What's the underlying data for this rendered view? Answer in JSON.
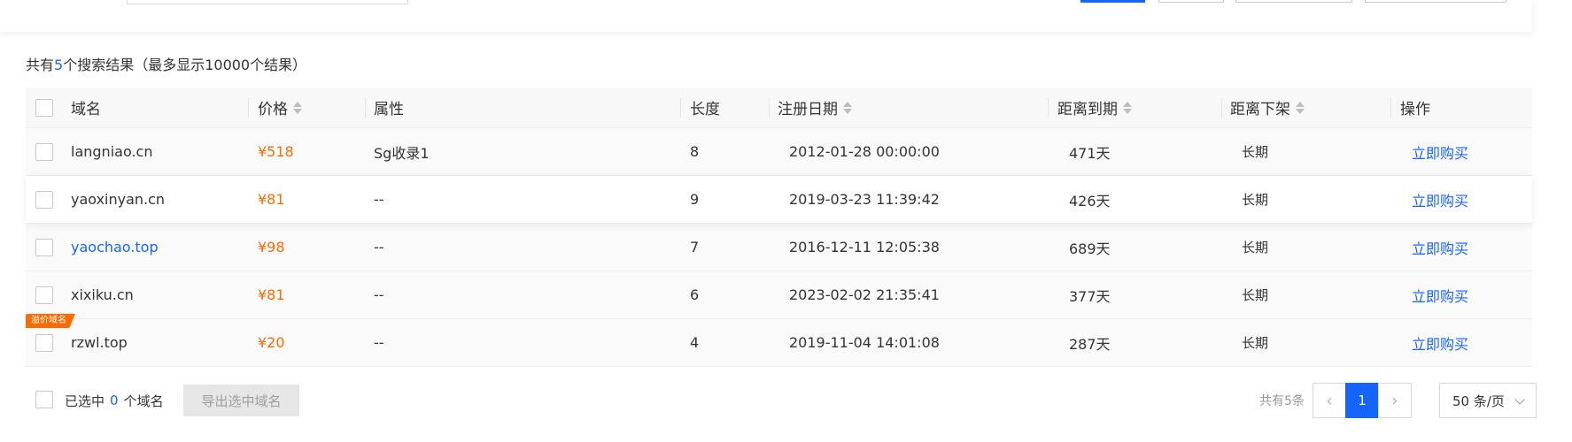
{
  "summary": {
    "prefix": "共有",
    "count": "5",
    "suffix": "个搜索结果（最多显示10000个结果）"
  },
  "table": {
    "columns": {
      "domain": "域名",
      "price": "价格",
      "attribute": "属性",
      "length": "长度",
      "register_date": "注册日期",
      "to_expire": "距离到期",
      "to_delist": "距离下架",
      "action": "操作"
    },
    "rows": [
      {
        "domain": "langniao.cn",
        "price": "¥518",
        "attribute": "Sg收录1",
        "length": "8",
        "register_date": "2012-01-28 00:00:00",
        "to_expire": "471天",
        "to_delist": "长期",
        "action": "立即购买"
      },
      {
        "domain": "yaoxinyan.cn",
        "price": "¥81",
        "attribute": "--",
        "length": "9",
        "register_date": "2019-03-23 11:39:42",
        "to_expire": "426天",
        "to_delist": "长期",
        "action": "立即购买"
      },
      {
        "domain": "yaochao.top",
        "price": "¥98",
        "attribute": "--",
        "length": "7",
        "register_date": "2016-12-11 12:05:38",
        "to_expire": "689天",
        "to_delist": "长期",
        "action": "立即购买"
      },
      {
        "domain": "xixiku.cn",
        "price": "¥81",
        "attribute": "--",
        "length": "6",
        "register_date": "2023-02-02 21:35:41",
        "to_expire": "377天",
        "to_delist": "长期",
        "action": "立即购买"
      },
      {
        "domain": "rzwl.top",
        "price": "¥20",
        "attribute": "--",
        "length": "4",
        "register_date": "2019-11-04 14:01:08",
        "to_expire": "287天",
        "to_delist": "长期",
        "action": "立即购买",
        "tag": "溢价域名"
      }
    ]
  },
  "footer": {
    "selected_prefix": "已选中",
    "selected_count": "0",
    "selected_suffix": "个域名",
    "export_label": "导出选中域名"
  },
  "pagination": {
    "total_text": "共有5条",
    "prev": "‹",
    "current_page": "1",
    "next": "›",
    "page_size": "50 条/页"
  },
  "colors": {
    "accent": "#1664ff",
    "price": "#ff6a00",
    "tag": "#ff6a00"
  }
}
